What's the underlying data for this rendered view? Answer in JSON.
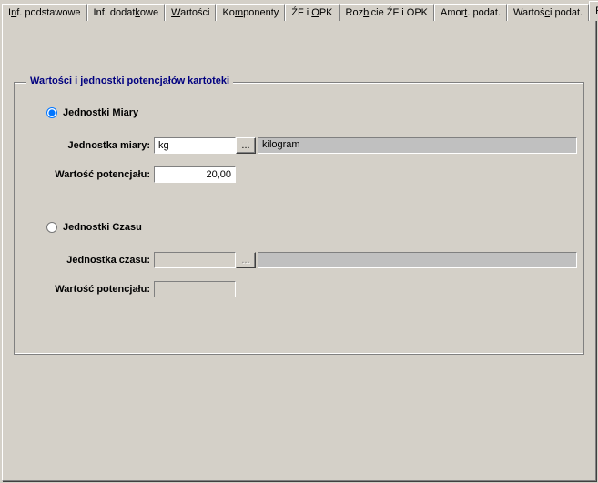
{
  "tabs": [
    {
      "pre": "I",
      "u": "n",
      "post": "f. podstawowe"
    },
    {
      "pre": "Inf. dodat",
      "u": "k",
      "post": "owe"
    },
    {
      "pre": "",
      "u": "W",
      "post": "artości"
    },
    {
      "pre": "Ko",
      "u": "m",
      "post": "ponenty"
    },
    {
      "pre": "ŹF i ",
      "u": "O",
      "post": "PK"
    },
    {
      "pre": "Roz",
      "u": "b",
      "post": "icie ŹF i OPK"
    },
    {
      "pre": "Amor",
      "u": "t",
      "post": ". podat."
    },
    {
      "pre": "Wartoś",
      "u": "c",
      "post": "i podat."
    },
    {
      "pre": "",
      "u": "P",
      "post": "otencjały"
    }
  ],
  "group": {
    "title": "Wartości i jednostki potencjałów kartoteki",
    "radio_unit_label": "Jednostki Miary",
    "radio_time_label": "Jednostki Czasu",
    "unit": {
      "label": "Jednostka miary:",
      "value": "kg",
      "browse": "...",
      "desc": "kilogram",
      "potential_label": "Wartość potencjału:",
      "potential_value": "20,00"
    },
    "time": {
      "label": "Jednostka czasu:",
      "value": "",
      "browse": "...",
      "desc": "",
      "potential_label": "Wartość potencjału:",
      "potential_value": ""
    }
  }
}
